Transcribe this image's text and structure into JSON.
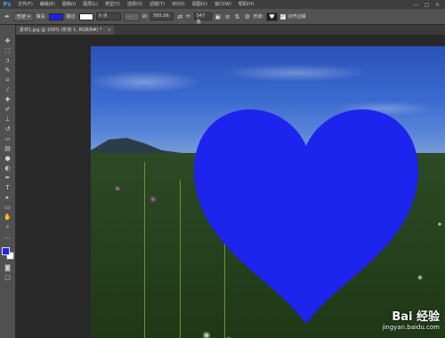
{
  "app": {
    "logo": "Ps"
  },
  "menu": [
    "文件(F)",
    "编辑(E)",
    "图像(I)",
    "图层(L)",
    "类型(Y)",
    "选择(S)",
    "滤镜(T)",
    "3D(D)",
    "视图(V)",
    "窗口(W)",
    "帮助(H)"
  ],
  "window_controls": [
    "—",
    "□",
    "×"
  ],
  "options": {
    "mode": "形状",
    "fill_label": "填充:",
    "fill_color": "#1d24e6",
    "stroke_label": "描边:",
    "stroke_width": "0 点",
    "w_label": "W:",
    "w_value": "565.06",
    "h_label": "H:",
    "h_value": "547 像",
    "shape_label": "形状:",
    "align_label": "对齐边缘"
  },
  "tab": {
    "title": "素材1.jpg @ 100% (形状 1, RGB/8#) *",
    "close": "×"
  },
  "colors": {
    "foreground": "#1d24e6",
    "background": "#ffffff",
    "heart": "#1c24ee"
  },
  "watermark": {
    "brand": "Bai 经验",
    "url": "jingyan.baidu.com"
  }
}
